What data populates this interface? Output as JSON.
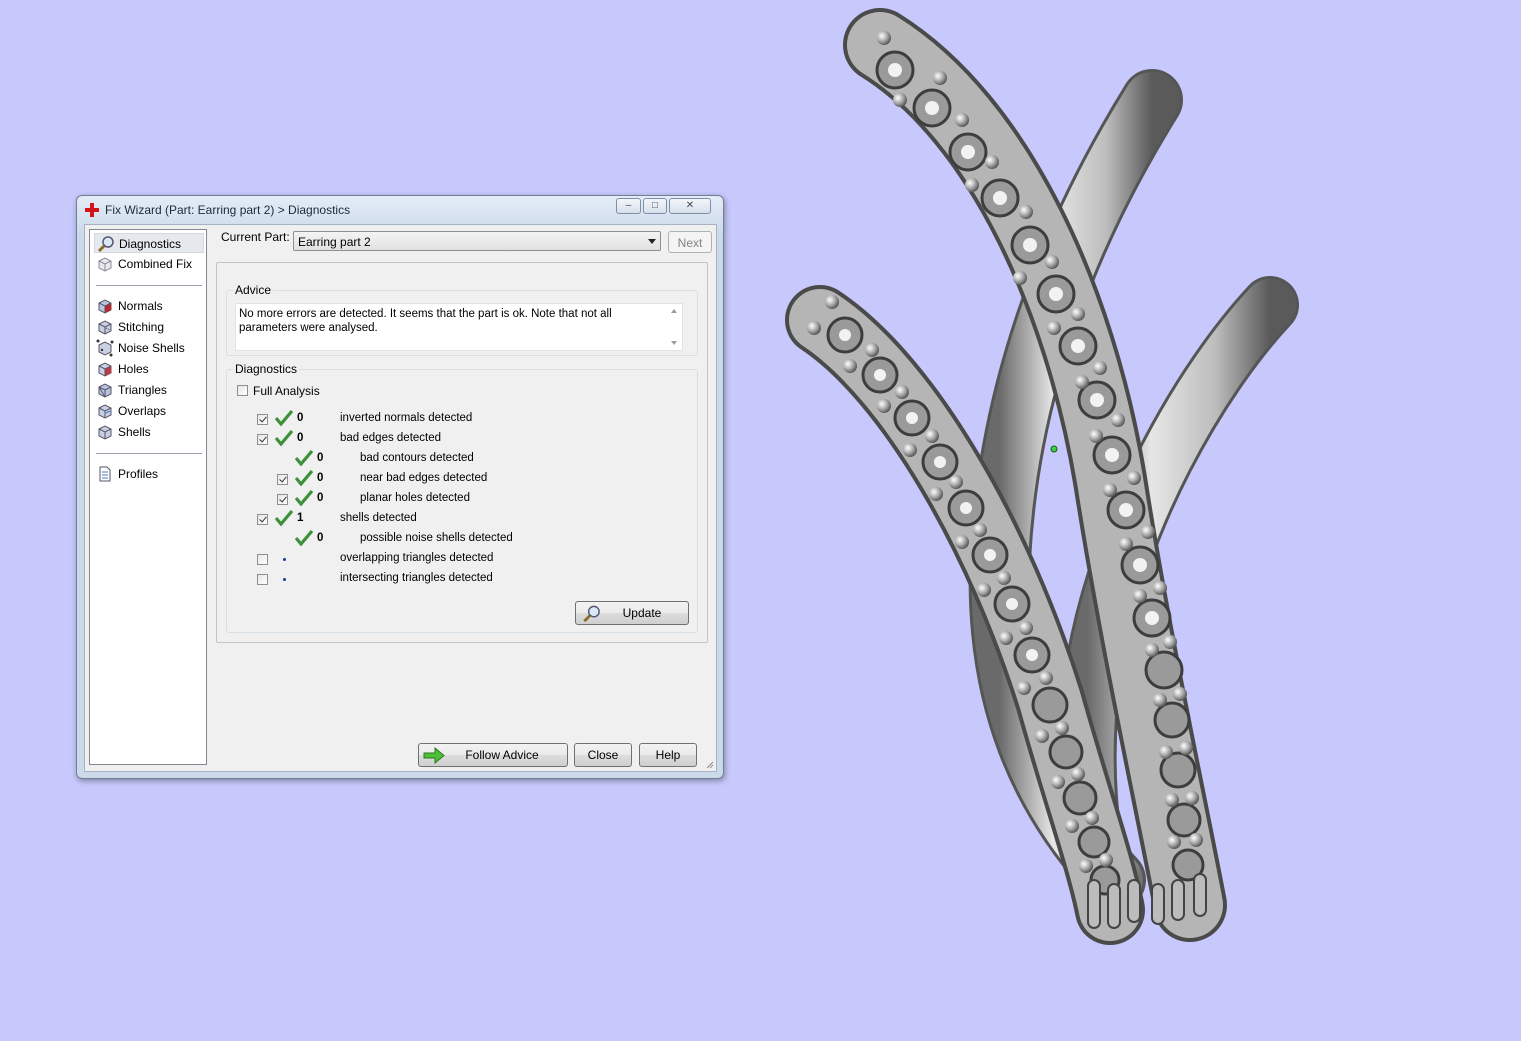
{
  "window": {
    "title": "Fix Wizard (Part: Earring part 2) > Diagnostics",
    "controls": {
      "minimize": "–",
      "maximize": "□",
      "close": "✕"
    }
  },
  "nav": {
    "group1": [
      {
        "label": "Diagnostics",
        "icon": "magnifier-icon",
        "selected": true
      },
      {
        "label": "Combined Fix",
        "icon": "cube-outline-icon"
      }
    ],
    "group2": [
      {
        "label": "Normals",
        "icon": "cube-red-face-icon"
      },
      {
        "label": "Stitching",
        "icon": "cube-stitch-icon"
      },
      {
        "label": "Noise Shells",
        "icon": "cube-dots-icon"
      },
      {
        "label": "Holes",
        "icon": "cube-hole-icon"
      },
      {
        "label": "Triangles",
        "icon": "cube-triangle-icon"
      },
      {
        "label": "Overlaps",
        "icon": "cube-overlap-icon"
      },
      {
        "label": "Shells",
        "icon": "cube-icon"
      }
    ],
    "group3": [
      {
        "label": "Profiles",
        "icon": "document-icon"
      }
    ]
  },
  "current_part": {
    "label": "Current Part:",
    "value": "Earring part 2",
    "next_label": "Next"
  },
  "advice": {
    "caption": "Advice",
    "text": "No more errors are detected. It seems that the part is ok. Note that not all parameters were analysed."
  },
  "diagnostics": {
    "caption": "Diagnostics",
    "full_analysis_label": "Full Analysis",
    "rows": [
      {
        "checkbox": true,
        "checked": true,
        "status": "ok",
        "count": "0",
        "label": "inverted normals detected",
        "indent": 0
      },
      {
        "checkbox": true,
        "checked": true,
        "status": "ok",
        "count": "0",
        "label": "bad edges detected",
        "indent": 0
      },
      {
        "checkbox": false,
        "checked": false,
        "status": "ok",
        "count": "0",
        "label": "bad contours detected",
        "indent": 1
      },
      {
        "checkbox": true,
        "checked": true,
        "status": "ok",
        "count": "0",
        "label": "near bad edges detected",
        "indent": 1
      },
      {
        "checkbox": true,
        "checked": true,
        "status": "ok",
        "count": "0",
        "label": "planar holes detected",
        "indent": 1
      },
      {
        "checkbox": true,
        "checked": true,
        "status": "ok",
        "count": "1",
        "label": "shells detected",
        "indent": 0
      },
      {
        "checkbox": false,
        "checked": false,
        "status": "ok",
        "count": "0",
        "label": "possible noise shells detected",
        "indent": 1
      },
      {
        "checkbox": true,
        "checked": false,
        "status": "none",
        "count": "",
        "label": "overlapping triangles detected",
        "indent": 0
      },
      {
        "checkbox": true,
        "checked": false,
        "status": "none",
        "count": "",
        "label": "intersecting triangles detected",
        "indent": 0
      }
    ],
    "update_label": "Update"
  },
  "footer": {
    "follow_advice_label": "Follow Advice",
    "close_label": "Close",
    "help_label": "Help"
  },
  "colors": {
    "background": "#c7c8fb",
    "model_gray": "#b9b9b9",
    "tick_green": "#3d8f3a"
  }
}
